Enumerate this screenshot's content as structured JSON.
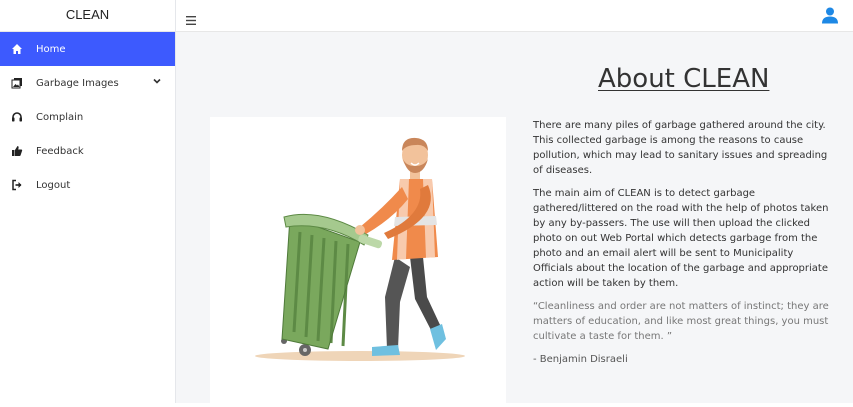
{
  "app": {
    "brand": "CLEAN"
  },
  "sidebar": {
    "items": [
      {
        "label": "Home",
        "icon": "home-icon",
        "active": true
      },
      {
        "label": "Garbage Images",
        "icon": "images-icon",
        "has_submenu": true
      },
      {
        "label": "Complain",
        "icon": "headset-icon"
      },
      {
        "label": "Feedback",
        "icon": "thumbs-up-icon"
      },
      {
        "label": "Logout",
        "icon": "logout-icon"
      }
    ]
  },
  "topbar": {
    "menu_icon": "hamburger-icon",
    "user_icon": "user-icon",
    "accent": "#1e88e5"
  },
  "main": {
    "title": "About CLEAN",
    "paragraphs": [
      "There are many piles of garbage gathered around the city. This collected garbage is among the reasons to cause pollution, which may lead to sanitary issues and spreading of diseases.",
      "The main aim of CLEAN is to detect garbage gathered/littered on the road with the help of photos taken by any by-passers. The use will then upload the clicked photo on out Web Portal which detects garbage from the photo and an email alert will be sent to Municipality Officials about the location of the garbage and appropriate action will be taken by them."
    ],
    "quote": "“Cleanliness and order are not matters of instinct; they are matters of education, and like most great things, you must cultivate a taste for them. ”",
    "author": "- Benjamin Disraeli",
    "illustration": "man-pushing-green-garbage-bin"
  },
  "colors": {
    "active_nav": "#3d5afe",
    "bin_green": "#7aa85d",
    "shirt_orange": "#f08a4b"
  }
}
